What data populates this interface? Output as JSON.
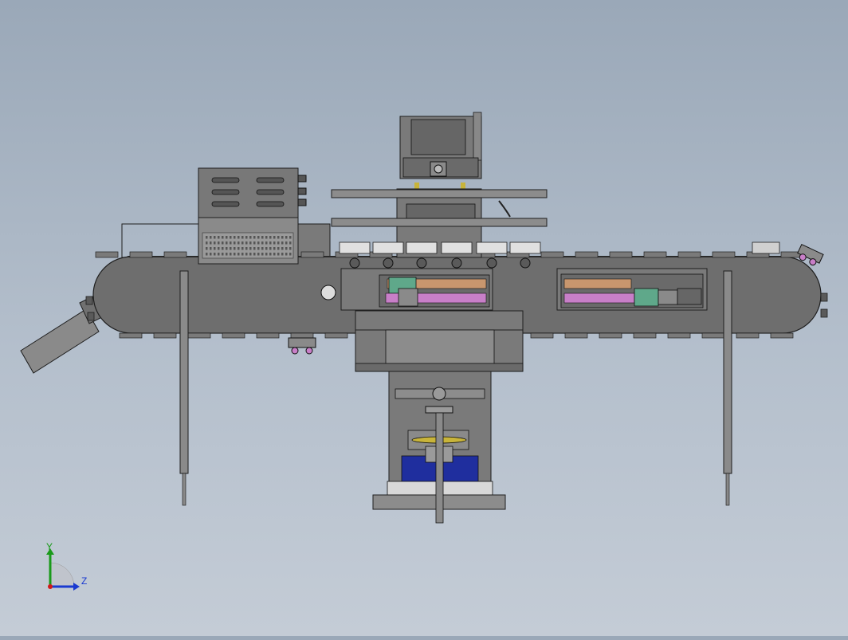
{
  "view": {
    "background_top": "#9aa8b8",
    "background_bottom": "#c4ccd6",
    "part_color": "#6e6e6e",
    "edge_color": "#1e1e1e",
    "screw_color": "#c87fc8",
    "shaft_color": "#c8966e",
    "motor_color": "#5fa88a",
    "block_color": "#1f2e9e",
    "gear_color": "#c8b43a"
  },
  "triad": {
    "y_label": "Y",
    "z_label": "Z",
    "y_color": "#1a9a1a",
    "z_color": "#1a3ad0",
    "x_color": "#d01a1a"
  }
}
